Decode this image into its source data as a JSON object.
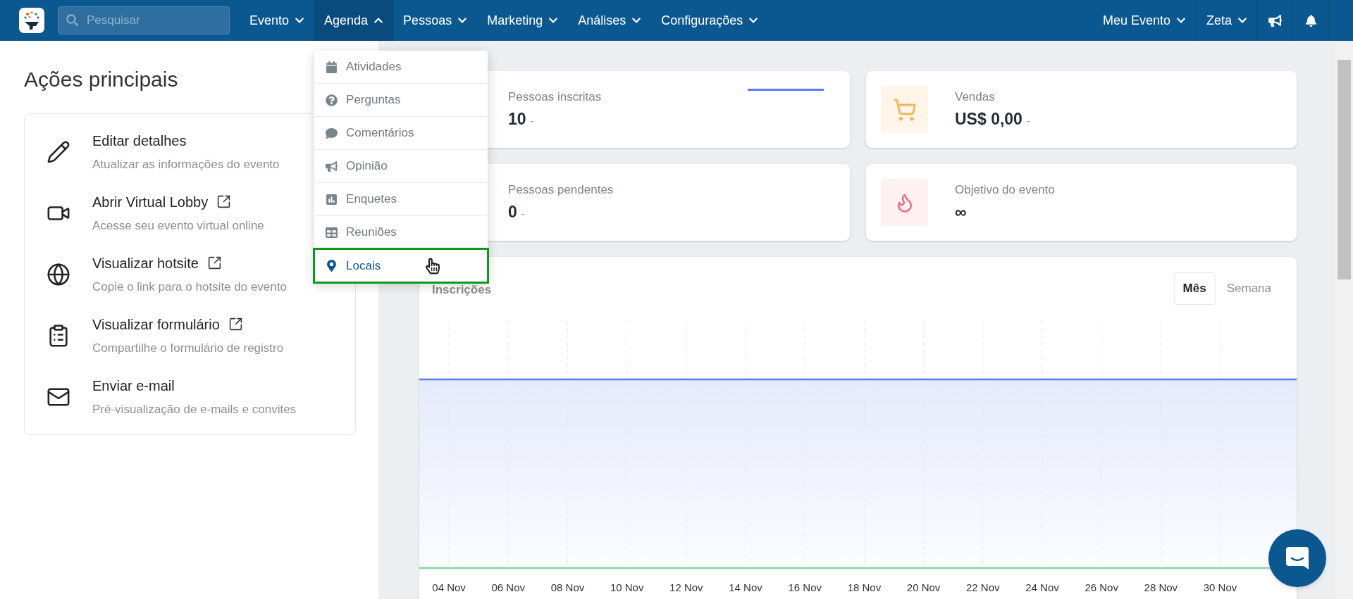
{
  "nav": {
    "search": {
      "placeholder": "Pesquisar"
    },
    "menus": [
      {
        "label": "Evento",
        "selected": false
      },
      {
        "label": "Agenda",
        "selected": true
      },
      {
        "label": "Pessoas",
        "selected": false
      },
      {
        "label": "Marketing",
        "selected": false
      },
      {
        "label": "Análises",
        "selected": false
      },
      {
        "label": "Configurações",
        "selected": false
      }
    ],
    "right_menus": [
      {
        "label": "Meu Evento"
      },
      {
        "label": "Zeta"
      }
    ]
  },
  "dropdown": {
    "items": [
      {
        "label": "Atividades",
        "kind": "calendar",
        "highlighted": false
      },
      {
        "label": "Perguntas",
        "kind": "question",
        "highlighted": false
      },
      {
        "label": "Comentários",
        "kind": "comment",
        "highlighted": false
      },
      {
        "label": "Opinião",
        "kind": "bullhorn",
        "highlighted": false
      },
      {
        "label": "Enquetes",
        "kind": "poll",
        "highlighted": false
      },
      {
        "label": "Reuniões",
        "kind": "table",
        "highlighted": false
      },
      {
        "label": "Locais",
        "kind": "marker",
        "highlighted": true
      }
    ]
  },
  "actions": {
    "title": "Ações principais",
    "items": [
      {
        "title": "Editar detalhes",
        "subtitle": "Atualizar as informações do evento",
        "kind": "pencil",
        "external": false
      },
      {
        "title": "Abrir Virtual Lobby",
        "subtitle": "Acesse seu evento virtual online",
        "kind": "video",
        "external": true
      },
      {
        "title": "Visualizar hotsite",
        "subtitle": "Copie o link para o hotsite do evento",
        "kind": "globe",
        "external": true
      },
      {
        "title": "Visualizar formulário",
        "subtitle": "Compartilhe o formulário de registro",
        "kind": "clipboard",
        "external": true
      },
      {
        "title": "Enviar e-mail",
        "subtitle": "Pré-visualização de e-mails e convites",
        "kind": "mail",
        "external": false
      }
    ]
  },
  "stats": [
    {
      "label": "Pessoas inscritas",
      "value": "10",
      "delta": "-",
      "kind": "plain",
      "legend": true
    },
    {
      "label": "Vendas",
      "value": "US$ 0,00",
      "delta": "-",
      "kind": "cart",
      "legend": false
    },
    {
      "label": "Pessoas pendentes",
      "value": "0",
      "delta": "-",
      "kind": "plain",
      "legend": false
    },
    {
      "label": "Objetivo do evento",
      "value": "∞",
      "kind": "flame",
      "legend": false
    }
  ],
  "chart": {
    "title": "Inscrições",
    "toggles": [
      {
        "label": "Mês",
        "selected": true
      },
      {
        "label": "Semana",
        "selected": false
      }
    ],
    "x_labels": [
      "04 Nov",
      "06 Nov",
      "08 Nov",
      "10 Nov",
      "12 Nov",
      "14 Nov",
      "16 Nov",
      "18 Nov",
      "20 Nov",
      "22 Nov",
      "24 Nov",
      "26 Nov",
      "28 Nov",
      "30 Nov"
    ]
  }
}
